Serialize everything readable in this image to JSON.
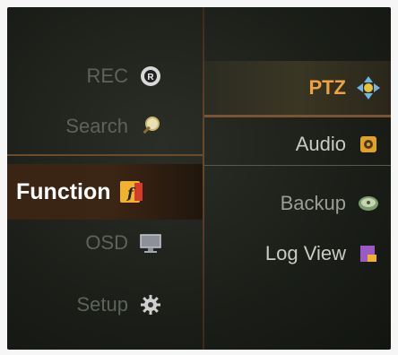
{
  "menu": {
    "left": [
      {
        "label": "REC",
        "icon": "rec-icon"
      },
      {
        "label": "Search",
        "icon": "search-icon"
      },
      {
        "label": "Function",
        "icon": "function-icon",
        "selected": true
      },
      {
        "label": "OSD",
        "icon": "monitor-icon"
      },
      {
        "label": "Setup",
        "icon": "gear-icon"
      }
    ],
    "right": [
      {
        "label": "PTZ",
        "icon": "ptz-arrows-icon",
        "selected": true
      },
      {
        "label": "Audio",
        "icon": "speaker-icon"
      },
      {
        "label": "Backup",
        "icon": "disc-icon"
      },
      {
        "label": "Log View",
        "icon": "log-icon"
      }
    ]
  },
  "colors": {
    "background": "#1b1e18",
    "selected_text": "#ffffff",
    "highlight_text": "#f0a23c",
    "divider": "#6b4a2a"
  }
}
